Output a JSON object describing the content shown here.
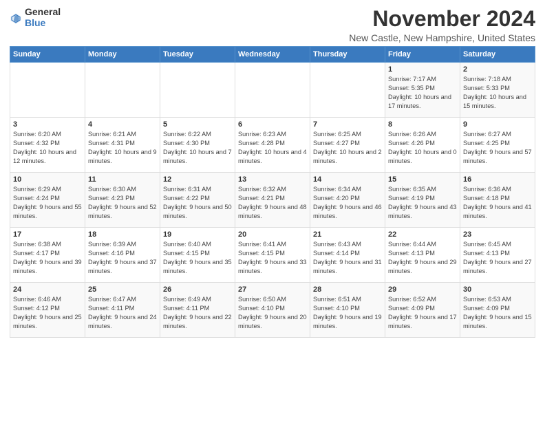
{
  "logo": {
    "text1": "General",
    "text2": "Blue"
  },
  "title": "November 2024",
  "location": "New Castle, New Hampshire, United States",
  "headers": [
    "Sunday",
    "Monday",
    "Tuesday",
    "Wednesday",
    "Thursday",
    "Friday",
    "Saturday"
  ],
  "weeks": [
    [
      {
        "day": "",
        "info": ""
      },
      {
        "day": "",
        "info": ""
      },
      {
        "day": "",
        "info": ""
      },
      {
        "day": "",
        "info": ""
      },
      {
        "day": "",
        "info": ""
      },
      {
        "day": "1",
        "info": "Sunrise: 7:17 AM\nSunset: 5:35 PM\nDaylight: 10 hours and 17 minutes."
      },
      {
        "day": "2",
        "info": "Sunrise: 7:18 AM\nSunset: 5:33 PM\nDaylight: 10 hours and 15 minutes."
      }
    ],
    [
      {
        "day": "3",
        "info": "Sunrise: 6:20 AM\nSunset: 4:32 PM\nDaylight: 10 hours and 12 minutes."
      },
      {
        "day": "4",
        "info": "Sunrise: 6:21 AM\nSunset: 4:31 PM\nDaylight: 10 hours and 9 minutes."
      },
      {
        "day": "5",
        "info": "Sunrise: 6:22 AM\nSunset: 4:30 PM\nDaylight: 10 hours and 7 minutes."
      },
      {
        "day": "6",
        "info": "Sunrise: 6:23 AM\nSunset: 4:28 PM\nDaylight: 10 hours and 4 minutes."
      },
      {
        "day": "7",
        "info": "Sunrise: 6:25 AM\nSunset: 4:27 PM\nDaylight: 10 hours and 2 minutes."
      },
      {
        "day": "8",
        "info": "Sunrise: 6:26 AM\nSunset: 4:26 PM\nDaylight: 10 hours and 0 minutes."
      },
      {
        "day": "9",
        "info": "Sunrise: 6:27 AM\nSunset: 4:25 PM\nDaylight: 9 hours and 57 minutes."
      }
    ],
    [
      {
        "day": "10",
        "info": "Sunrise: 6:29 AM\nSunset: 4:24 PM\nDaylight: 9 hours and 55 minutes."
      },
      {
        "day": "11",
        "info": "Sunrise: 6:30 AM\nSunset: 4:23 PM\nDaylight: 9 hours and 52 minutes."
      },
      {
        "day": "12",
        "info": "Sunrise: 6:31 AM\nSunset: 4:22 PM\nDaylight: 9 hours and 50 minutes."
      },
      {
        "day": "13",
        "info": "Sunrise: 6:32 AM\nSunset: 4:21 PM\nDaylight: 9 hours and 48 minutes."
      },
      {
        "day": "14",
        "info": "Sunrise: 6:34 AM\nSunset: 4:20 PM\nDaylight: 9 hours and 46 minutes."
      },
      {
        "day": "15",
        "info": "Sunrise: 6:35 AM\nSunset: 4:19 PM\nDaylight: 9 hours and 43 minutes."
      },
      {
        "day": "16",
        "info": "Sunrise: 6:36 AM\nSunset: 4:18 PM\nDaylight: 9 hours and 41 minutes."
      }
    ],
    [
      {
        "day": "17",
        "info": "Sunrise: 6:38 AM\nSunset: 4:17 PM\nDaylight: 9 hours and 39 minutes."
      },
      {
        "day": "18",
        "info": "Sunrise: 6:39 AM\nSunset: 4:16 PM\nDaylight: 9 hours and 37 minutes."
      },
      {
        "day": "19",
        "info": "Sunrise: 6:40 AM\nSunset: 4:15 PM\nDaylight: 9 hours and 35 minutes."
      },
      {
        "day": "20",
        "info": "Sunrise: 6:41 AM\nSunset: 4:15 PM\nDaylight: 9 hours and 33 minutes."
      },
      {
        "day": "21",
        "info": "Sunrise: 6:43 AM\nSunset: 4:14 PM\nDaylight: 9 hours and 31 minutes."
      },
      {
        "day": "22",
        "info": "Sunrise: 6:44 AM\nSunset: 4:13 PM\nDaylight: 9 hours and 29 minutes."
      },
      {
        "day": "23",
        "info": "Sunrise: 6:45 AM\nSunset: 4:13 PM\nDaylight: 9 hours and 27 minutes."
      }
    ],
    [
      {
        "day": "24",
        "info": "Sunrise: 6:46 AM\nSunset: 4:12 PM\nDaylight: 9 hours and 25 minutes."
      },
      {
        "day": "25",
        "info": "Sunrise: 6:47 AM\nSunset: 4:11 PM\nDaylight: 9 hours and 24 minutes."
      },
      {
        "day": "26",
        "info": "Sunrise: 6:49 AM\nSunset: 4:11 PM\nDaylight: 9 hours and 22 minutes."
      },
      {
        "day": "27",
        "info": "Sunrise: 6:50 AM\nSunset: 4:10 PM\nDaylight: 9 hours and 20 minutes."
      },
      {
        "day": "28",
        "info": "Sunrise: 6:51 AM\nSunset: 4:10 PM\nDaylight: 9 hours and 19 minutes."
      },
      {
        "day": "29",
        "info": "Sunrise: 6:52 AM\nSunset: 4:09 PM\nDaylight: 9 hours and 17 minutes."
      },
      {
        "day": "30",
        "info": "Sunrise: 6:53 AM\nSunset: 4:09 PM\nDaylight: 9 hours and 15 minutes."
      }
    ]
  ]
}
